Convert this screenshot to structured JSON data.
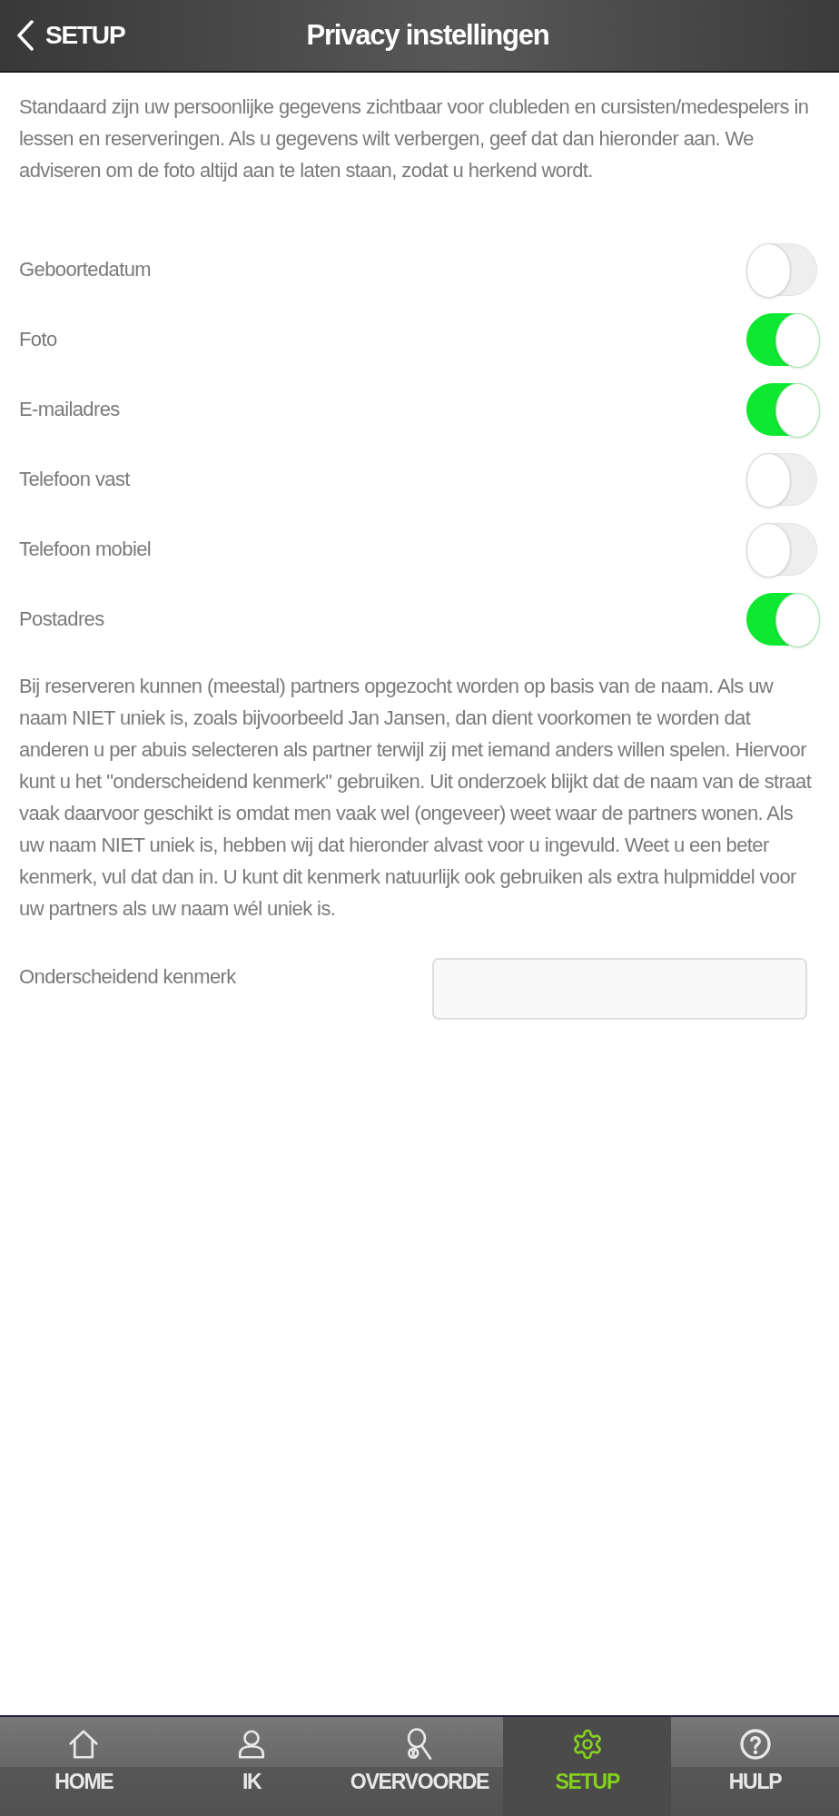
{
  "header": {
    "back_label": "SETUP",
    "title": "Privacy instellingen"
  },
  "intro": "Standaard zijn uw persoonlijke gegevens zichtbaar voor clubleden en cursisten/medespelers in lessen en reserveringen. Als u gegevens wilt verbergen, geef dat dan hieronder aan. We adviseren om de foto altijd aan te laten staan, zodat u herkend wordt.",
  "settings": [
    {
      "label": "Geboortedatum",
      "on": false
    },
    {
      "label": "Foto",
      "on": true
    },
    {
      "label": "E-mailadres",
      "on": true
    },
    {
      "label": "Telefoon vast",
      "on": false
    },
    {
      "label": "Telefoon mobiel",
      "on": false
    },
    {
      "label": "Postadres",
      "on": true
    }
  ],
  "explanation": "Bij reserveren kunnen (meestal) partners opgezocht worden op basis van de naam. Als uw naam NIET uniek is, zoals bijvoorbeeld Jan Jansen, dan dient voorkomen te worden dat anderen u per abuis selecteren als partner terwijl zij met iemand anders willen spelen. Hiervoor kunt u het \"onderscheidend kenmerk\" gebruiken. Uit onderzoek blijkt dat de naam van de straat vaak daarvoor geschikt is omdat men vaak wel (ongeveer) weet waar de partners wonen. Als uw naam NIET uniek is, hebben wij dat hieronder alvast voor u ingevuld. Weet u een beter kenmerk, vul dat dan in. U kunt dit kenmerk natuurlijk ook gebruiken als extra hulpmiddel voor uw partners als uw naam wél uniek is.",
  "distinguishing_field": {
    "label": "Onderscheidend kenmerk"
  },
  "nav": [
    {
      "label": "HOME",
      "selected": false
    },
    {
      "label": "IK",
      "selected": false
    },
    {
      "label": "OVERVOORDE",
      "selected": false
    },
    {
      "label": "SETUP",
      "selected": true
    },
    {
      "label": "HULP",
      "selected": false
    }
  ]
}
